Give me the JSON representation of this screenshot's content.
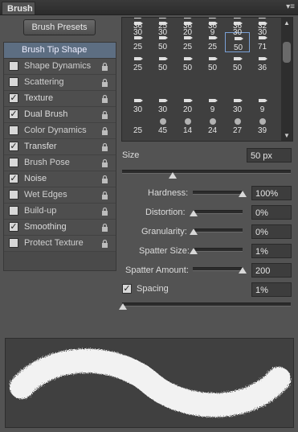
{
  "panel": {
    "title": "Brush",
    "menu_glyph": "≡"
  },
  "presets_button": "Brush Presets",
  "options": {
    "header": "Brush Tip Shape",
    "items": [
      {
        "label": "Shape Dynamics",
        "checked": false
      },
      {
        "label": "Scattering",
        "checked": false
      },
      {
        "label": "Texture",
        "checked": true
      },
      {
        "label": "Dual Brush",
        "checked": true
      },
      {
        "label": "Color Dynamics",
        "checked": false
      },
      {
        "label": "Transfer",
        "checked": true
      },
      {
        "label": "Brush Pose",
        "checked": false
      },
      {
        "label": "Noise",
        "checked": true
      },
      {
        "label": "Wet Edges",
        "checked": false
      },
      {
        "label": "Build-up",
        "checked": false
      },
      {
        "label": "Smoothing",
        "checked": true
      },
      {
        "label": "Protect Texture",
        "checked": false
      }
    ]
  },
  "brush_grid": {
    "rows": [
      [
        "36",
        "25",
        "36",
        "36",
        "36",
        "32"
      ],
      [
        "25",
        "50",
        "25",
        "25",
        "50",
        "71"
      ],
      [
        "25",
        "50",
        "50",
        "50",
        "50",
        "36"
      ],
      [
        "30",
        "30",
        "20",
        "9",
        "30",
        "30"
      ],
      [
        "25",
        "50",
        "50",
        "50",
        "50",
        "36"
      ],
      [
        "30",
        "30",
        "20",
        "9",
        "30",
        "9"
      ],
      [
        "25",
        "45",
        "14",
        "24",
        "27",
        "39"
      ]
    ],
    "selected_row": 1,
    "selected_col": 4
  },
  "size": {
    "label": "Size",
    "value": "50 px",
    "slider_fraction": 0.3
  },
  "hardness": {
    "label": "Hardness:",
    "value": "100%",
    "fraction": 1.0
  },
  "distortion": {
    "label": "Distortion:",
    "value": "0%",
    "fraction": 0.0
  },
  "granularity": {
    "label": "Granularity:",
    "value": "0%",
    "fraction": 0.0
  },
  "spatter_size": {
    "label": "Spatter Size:",
    "value": "1%",
    "fraction": 0.0
  },
  "spatter_amount": {
    "label": "Spatter Amount:",
    "value": "200",
    "fraction": 1.0
  },
  "spacing": {
    "label": "Spacing",
    "checked": true,
    "value": "1%",
    "fraction": 0.0
  }
}
